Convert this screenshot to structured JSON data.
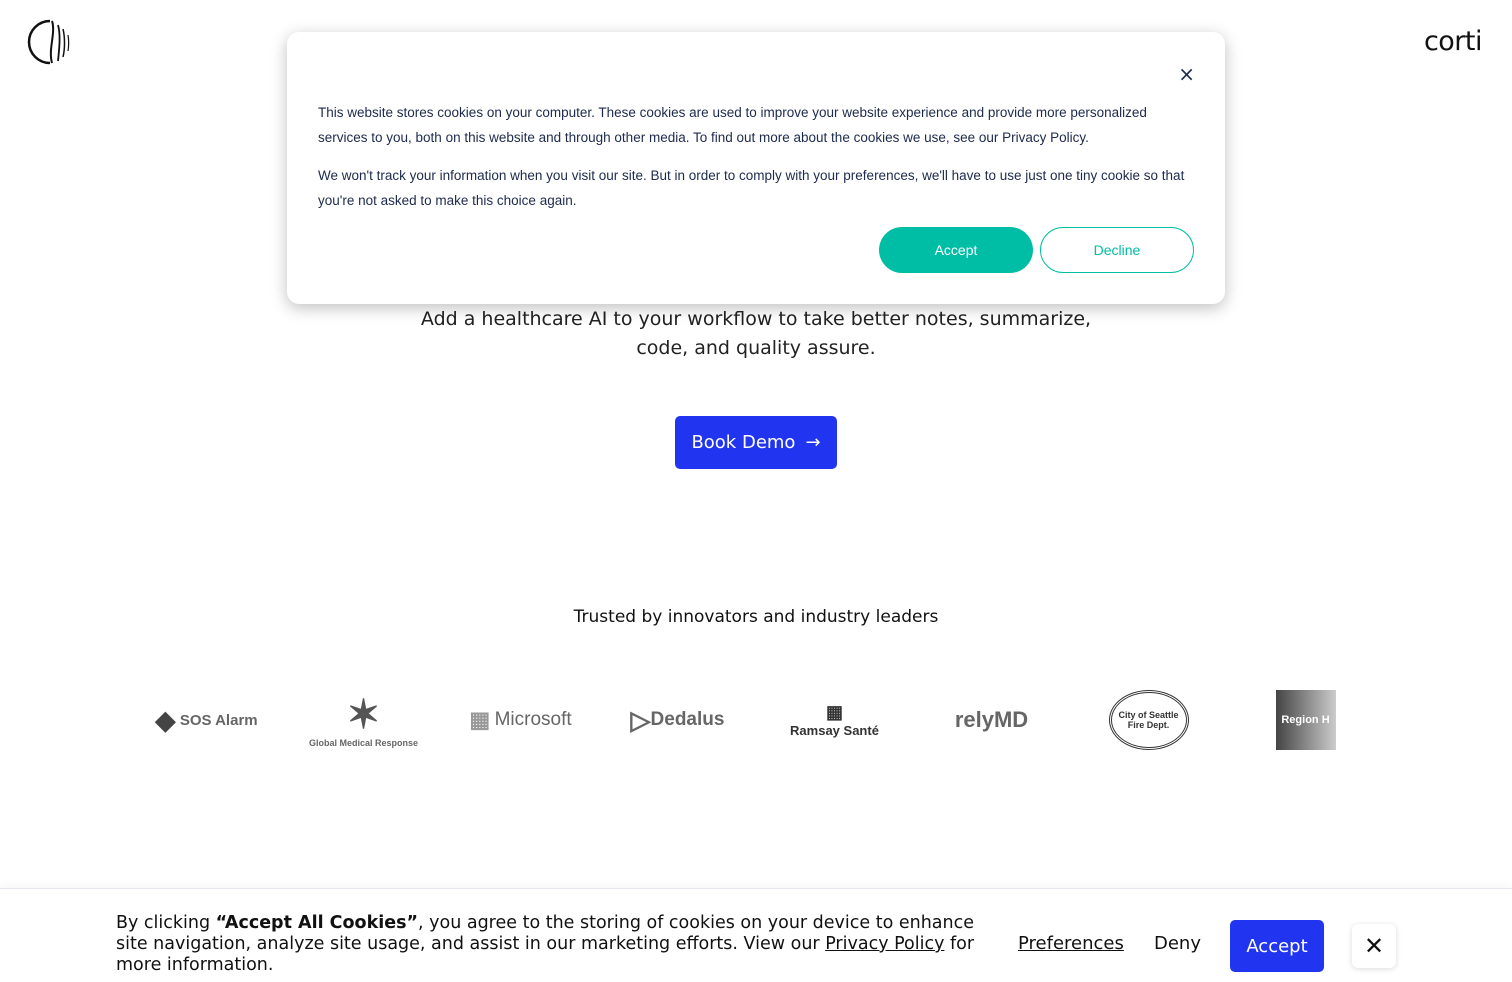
{
  "header": {
    "wordmark": "corti"
  },
  "hero": {
    "subtitle": "Add a healthcare AI to your workflow to take better notes, summarize, code, and quality assure.",
    "cta": "Book Demo"
  },
  "trusted": {
    "heading": "Trusted by innovators and industry leaders",
    "logos": [
      "SOS Alarm",
      "Global Medical Response",
      "Microsoft",
      "Dedalus",
      "Ramsay Santé",
      "relyMD",
      "City of Seattle Fire Dept.",
      "Region H"
    ]
  },
  "modal": {
    "p1": "This website stores cookies on your computer. These cookies are used to improve your website experience and provide more personalized services to you, both on this website and through other media. To find out more about the cookies we use, see our Privacy Policy.",
    "p2": "We won't track your information when you visit our site. But in order to comply with your preferences, we'll have to use just one tiny cookie so that you're not asked to make this choice again.",
    "accept": "Accept",
    "decline": "Decline",
    "close": "×"
  },
  "banner": {
    "pre": "By clicking ",
    "bold": "“Accept All Cookies”",
    "mid": ", you agree to the storing of cookies on your device to enhance site navigation, analyze site usage, and assist in our marketing efforts. View our ",
    "link": "Privacy Policy",
    "post": " for more information.",
    "preferences": "Preferences",
    "deny": "Deny",
    "accept": "Accept",
    "close": "✕"
  },
  "colors": {
    "primary": "#2135f0",
    "teal": "#00bda5"
  }
}
